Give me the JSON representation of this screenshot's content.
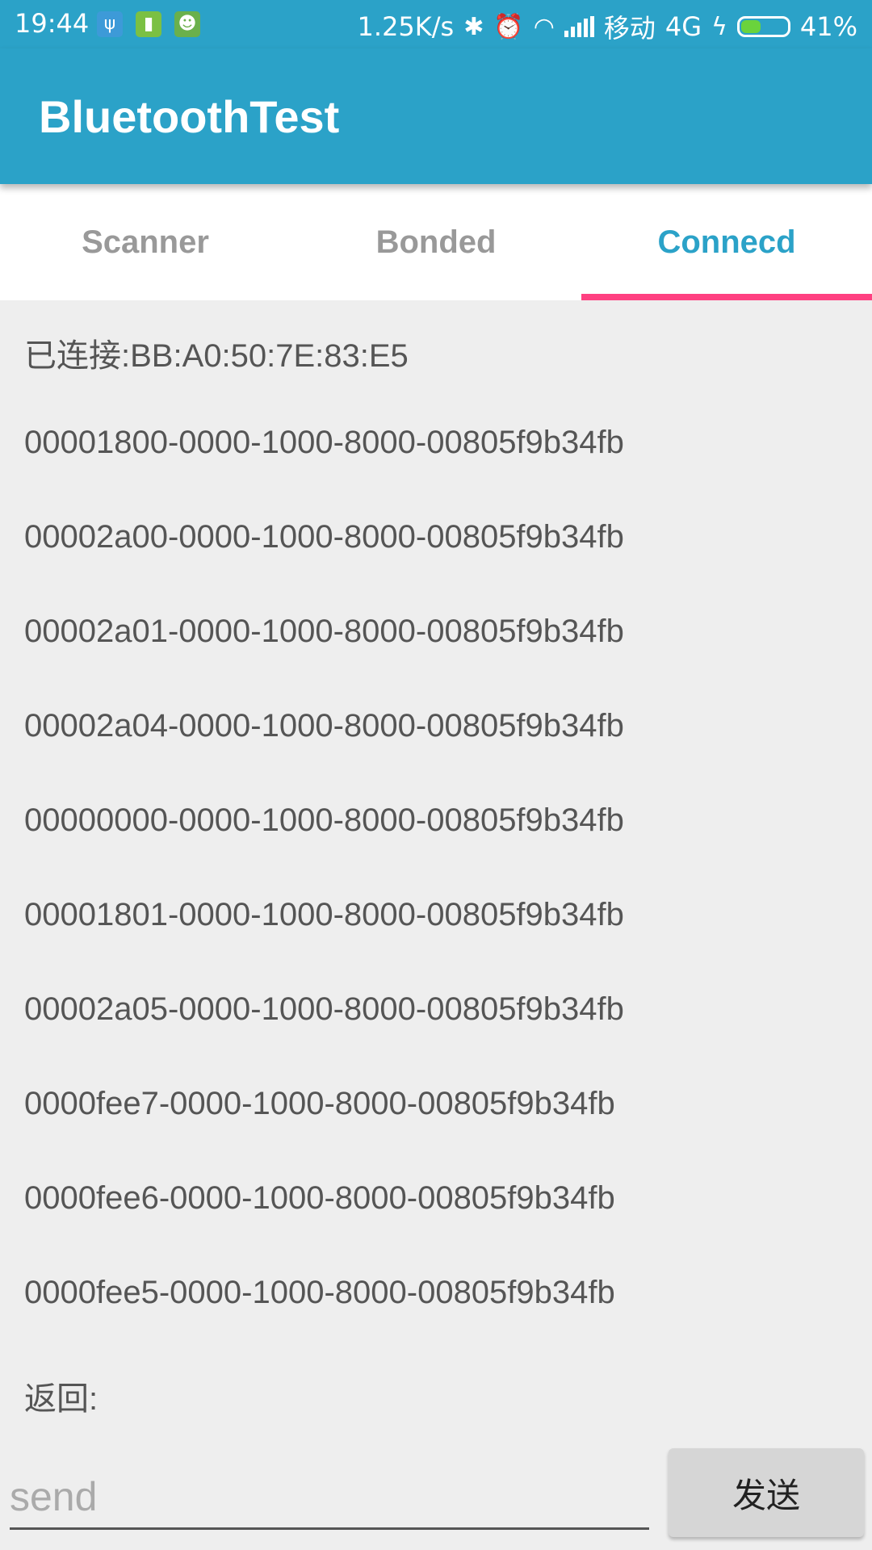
{
  "status_bar": {
    "time": "19:44",
    "left_icons": [
      {
        "name": "usb-icon",
        "color": "#3d9ad8",
        "glyph": "ψ"
      },
      {
        "name": "battery-saver-icon",
        "color": "#7bc043",
        "glyph": "▮"
      },
      {
        "name": "android-debug-icon",
        "color": "#6ab04c",
        "glyph": "☻"
      }
    ],
    "net_speed": "1.25K/s",
    "carrier": "移动",
    "network_type": "4G",
    "battery_percent": "41%",
    "battery_level": 0.41
  },
  "app_bar": {
    "title": "BluetoothTest"
  },
  "tabs": [
    {
      "label": "Scanner",
      "active": false
    },
    {
      "label": "Bonded",
      "active": false
    },
    {
      "label": "Connecd",
      "active": true
    }
  ],
  "content": {
    "connected_label": "已连接:BB:A0:50:7E:83:E5",
    "uuids": [
      "00001800-0000-1000-8000-00805f9b34fb",
      "00002a00-0000-1000-8000-00805f9b34fb",
      "00002a01-0000-1000-8000-00805f9b34fb",
      "00002a04-0000-1000-8000-00805f9b34fb",
      "00000000-0000-1000-8000-00805f9b34fb",
      "00001801-0000-1000-8000-00805f9b34fb",
      "00002a05-0000-1000-8000-00805f9b34fb",
      "0000fee7-0000-1000-8000-00805f9b34fb",
      "0000fee6-0000-1000-8000-00805f9b34fb",
      "0000fee5-0000-1000-8000-00805f9b34fb"
    ],
    "return_label": "返回:"
  },
  "input": {
    "value": "",
    "placeholder": "send"
  },
  "send_button": {
    "label": "发送"
  }
}
